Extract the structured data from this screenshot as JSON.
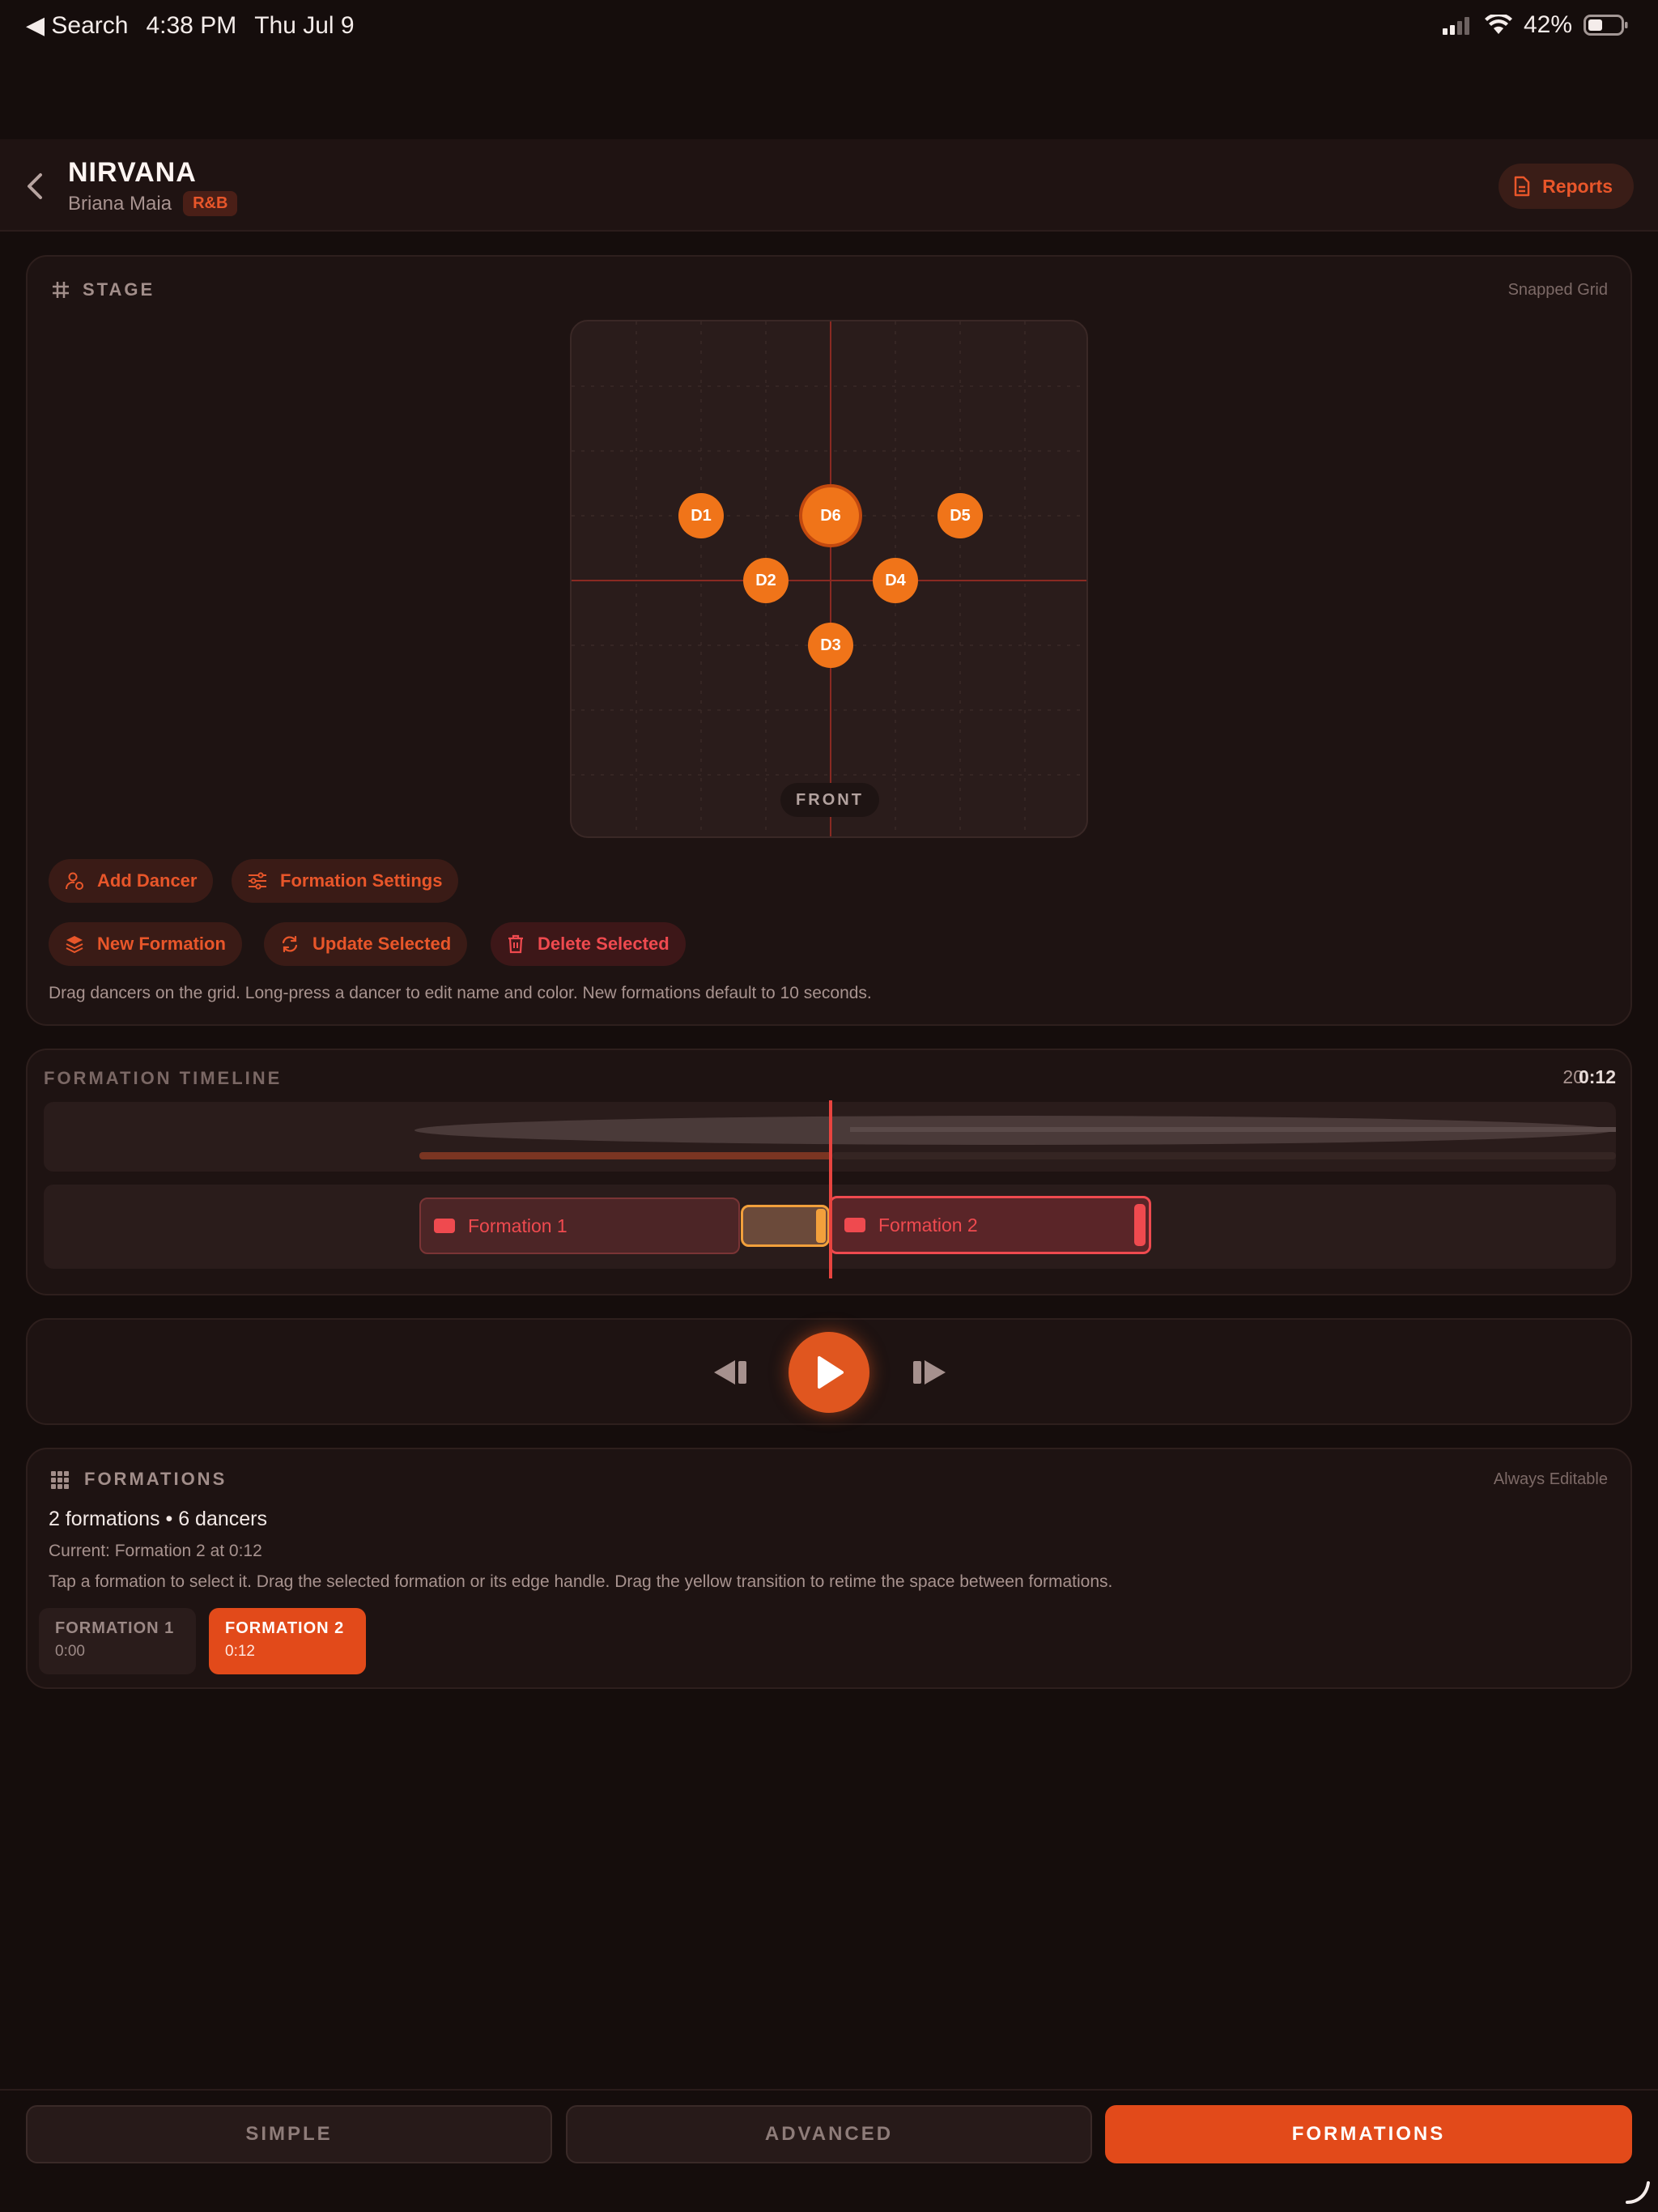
{
  "status_bar": {
    "back_app": "◀ Search",
    "time": "4:38 PM",
    "date": "Thu Jul 9",
    "battery": "42%"
  },
  "header": {
    "title": "NIRVANA",
    "artist": "Briana Maia",
    "genre": "R&B",
    "reports_label": "Reports"
  },
  "stage": {
    "label": "STAGE",
    "grid_mode": "Snapped Grid",
    "front_label": "FRONT",
    "dancers": [
      "D1",
      "D6",
      "D5",
      "D2",
      "D4",
      "D3"
    ],
    "selected_dancer": "D6",
    "buttons": {
      "add_dancer": "Add Dancer",
      "formation_settings": "Formation Settings",
      "new_formation": "New Formation",
      "update_selected": "Update Selected",
      "delete_selected": "Delete Selected"
    },
    "hint": "Drag dancers on the grid. Long-press a dancer to edit name and color. New formations default to 10 seconds."
  },
  "timeline": {
    "label": "FORMATION TIMELINE",
    "zoom": "20",
    "current_time": "0:12",
    "formation_1": "Formation 1",
    "formation_2": "Formation 2"
  },
  "formations": {
    "label": "FORMATIONS",
    "mode": "Always Editable",
    "summary": "2 formations • 6 dancers",
    "current": "Current: Formation 2 at 0:12",
    "hint": "Tap a formation to select it. Drag the selected formation or its edge handle. Drag the yellow transition to retime the space between formations.",
    "chips": [
      {
        "name": "FORMATION 1",
        "time": "0:00"
      },
      {
        "name": "FORMATION 2",
        "time": "0:12"
      }
    ]
  },
  "tabs": [
    "SIMPLE",
    "ADVANCED",
    "FORMATIONS"
  ],
  "colors": {
    "accent": "#e8562a",
    "dancer": "#f07419",
    "danger": "#ef4a4f",
    "playhead": "#e8443f",
    "transition": "#f2a03c"
  }
}
